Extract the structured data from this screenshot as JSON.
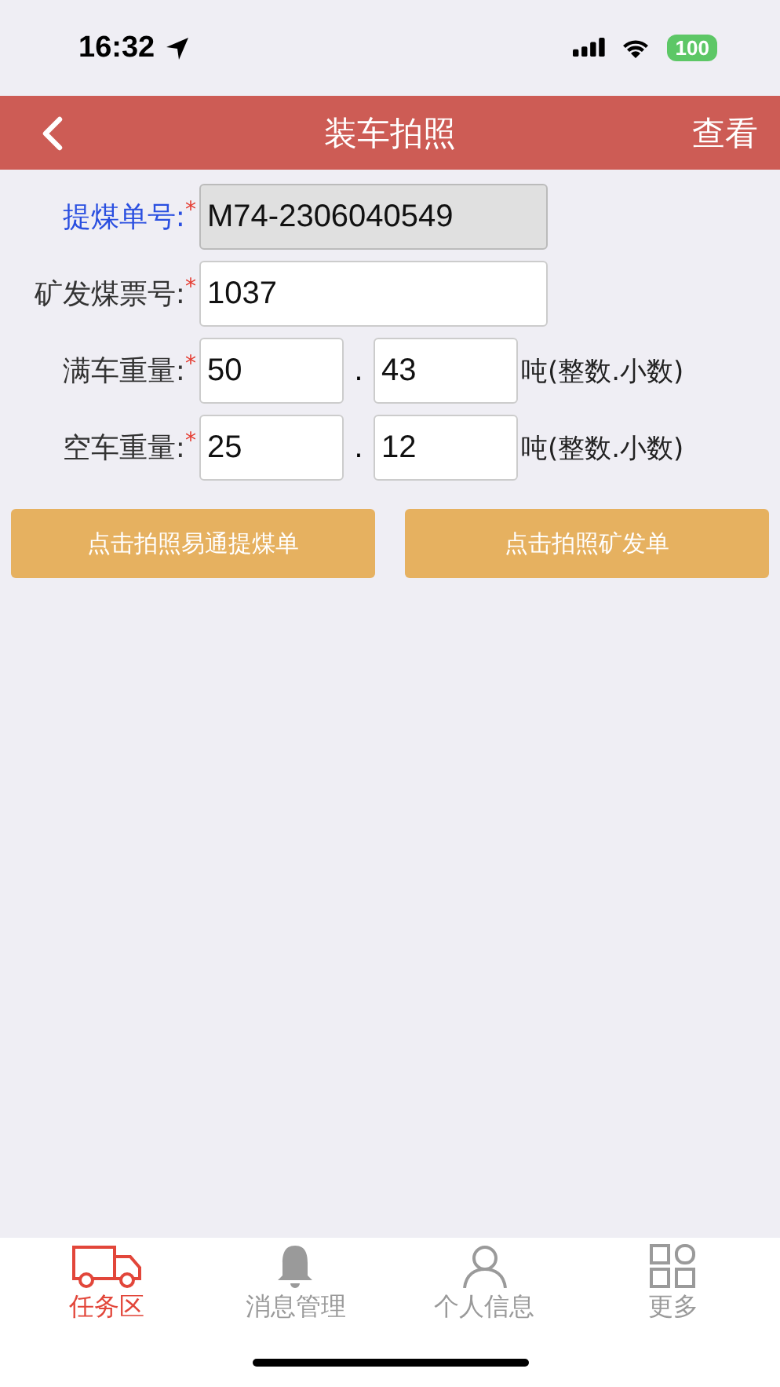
{
  "status_bar": {
    "time": "16:32",
    "battery": "100"
  },
  "nav": {
    "title": "装车拍照",
    "action": "查看"
  },
  "fields": [
    {
      "kind": "single",
      "label": "提煤单号:",
      "label_highlighted": true,
      "required_mark": "*",
      "value": "M74-2306040549",
      "disabled": true
    },
    {
      "kind": "single",
      "label": "矿发煤票号:",
      "label_highlighted": false,
      "required_mark": "*",
      "value": "1037",
      "disabled": false
    },
    {
      "kind": "split",
      "label": "满车重量:",
      "label_highlighted": false,
      "required_mark": "*",
      "integer": "50",
      "separator": ".",
      "decimal": "43",
      "unit": "吨(整数.小数)"
    },
    {
      "kind": "split",
      "label": "空车重量:",
      "label_highlighted": false,
      "required_mark": "*",
      "integer": "25",
      "separator": ".",
      "decimal": "12",
      "unit": "吨(整数.小数)"
    }
  ],
  "buttons": [
    "点击拍照易通提煤单",
    "点击拍照矿发单"
  ],
  "tabs": [
    {
      "kind": "truck",
      "label": "任务区",
      "selected": true
    },
    {
      "kind": "bell",
      "label": "消息管理",
      "selected": false
    },
    {
      "kind": "person",
      "label": "个人信息",
      "selected": false
    },
    {
      "kind": "grid",
      "label": "更多",
      "selected": false
    }
  ]
}
